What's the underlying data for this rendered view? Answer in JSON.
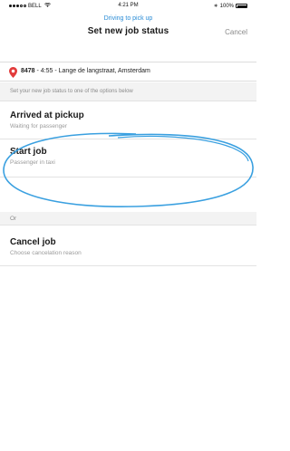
{
  "status_bar": {
    "carrier": "BELL",
    "time": "4:21 PM",
    "battery": "100%",
    "battery_level": 1.0,
    "signal_bars_on": 3,
    "signal_bars_total": 5
  },
  "nav": {
    "subtitle": "Driving to pick up",
    "title": "Set new job status",
    "cancel": "Cancel"
  },
  "job": {
    "id": "8478",
    "details": " - 4:55 - Lange de langstraat, Amsterdam"
  },
  "instruction": "Set your new job status to one of the options below",
  "options": [
    {
      "label": "Arrived at pickup",
      "sub": "Waiting for passenger"
    },
    {
      "label": "Start job",
      "sub": "Passenger in taxi"
    }
  ],
  "separator": "Or",
  "cancel_option": {
    "label": "Cancel job",
    "sub": "Choose cancelation reason"
  },
  "colors": {
    "accent": "#2a8cd6",
    "pin": "#e23b3b",
    "highlight": "#3aa0e0"
  },
  "icons": {
    "pin": "location-pin-icon",
    "wifi": "wifi-icon",
    "battery": "battery-icon"
  }
}
